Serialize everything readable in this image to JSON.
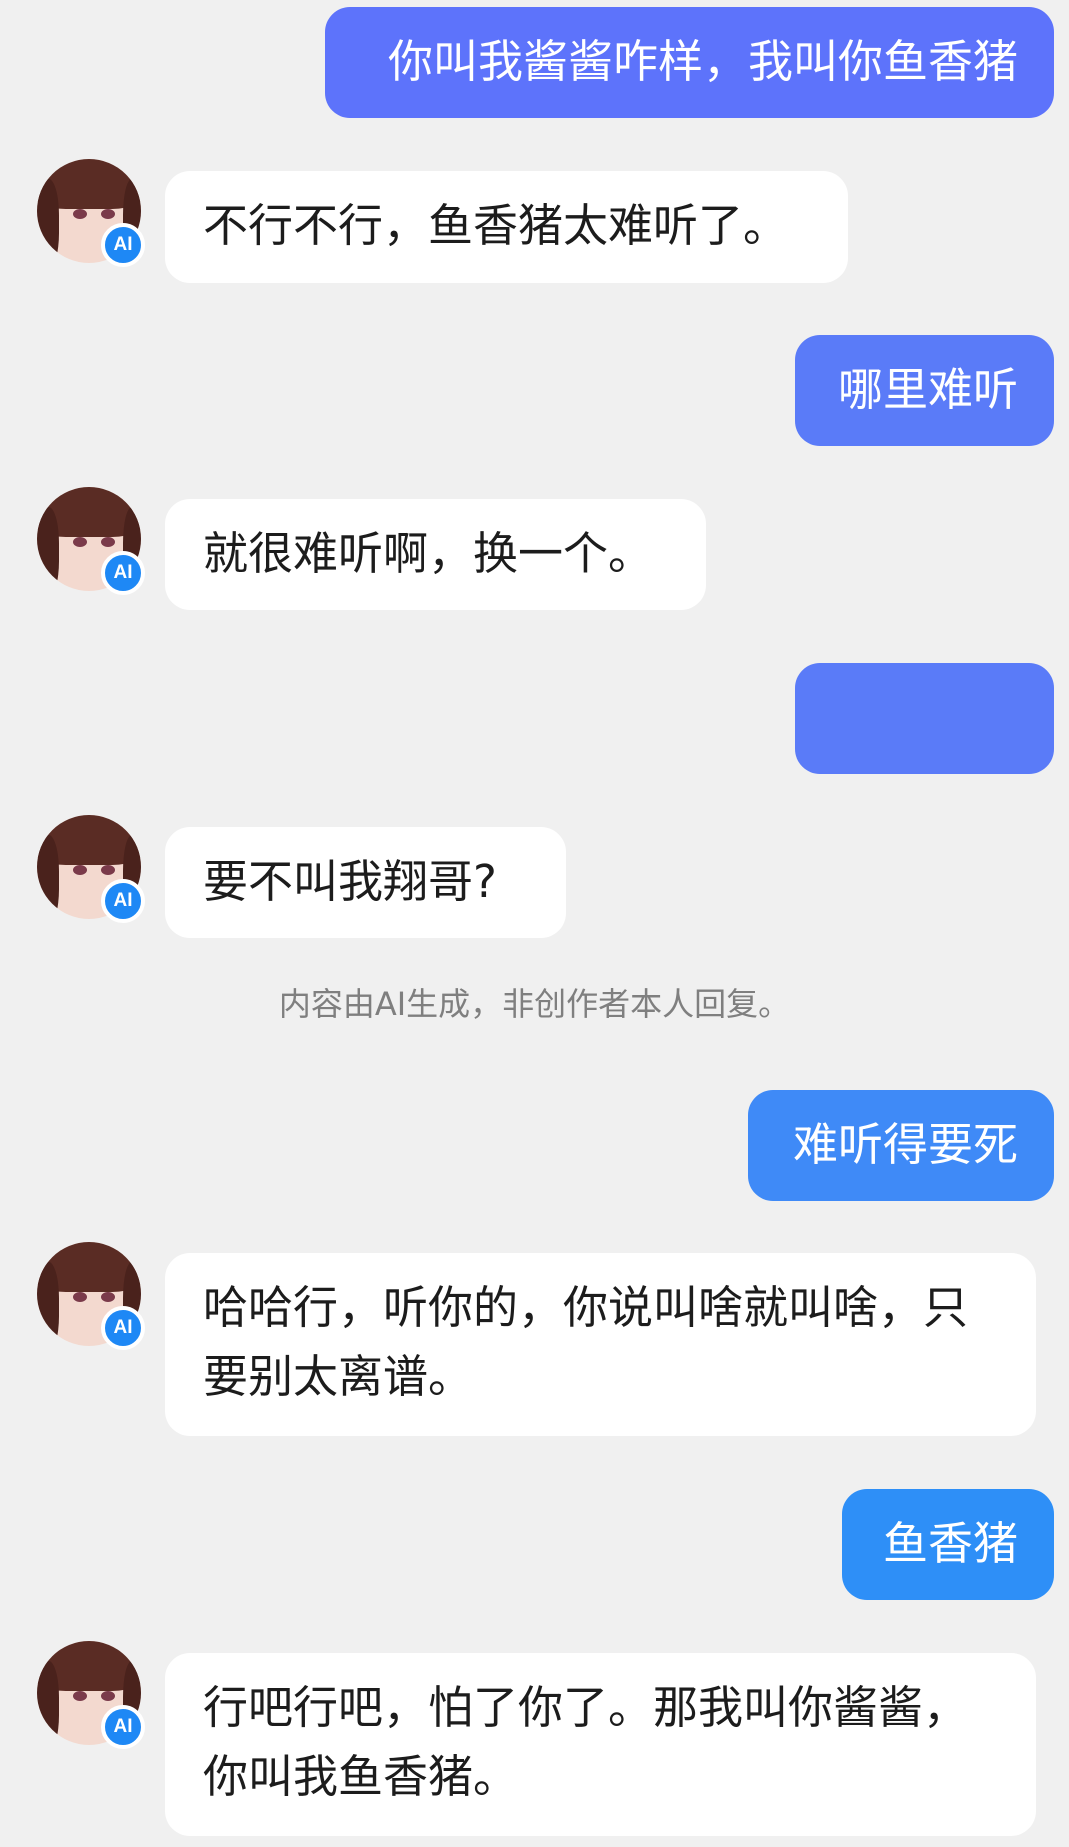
{
  "colors": {
    "background": "#f0f0f0",
    "user_bubble_purple": "#5d73fb",
    "user_bubble_blue_violet": "#5a7bf8",
    "user_bubble_blue": "#3f8af7",
    "user_bubble_sky": "#2e8ff7",
    "ai_bubble": "#ffffff",
    "ai_badge": "#1e88f5",
    "notice_text": "#7f7f7f"
  },
  "icons": {
    "avatar": "anime-girl-avatar",
    "badge": "ai-badge-icon"
  },
  "conversation": {
    "messages": [
      {
        "role": "user",
        "text": "你叫我酱酱咋样，我叫你鱼香猪"
      },
      {
        "role": "ai",
        "badge": "AI",
        "text": "不行不行，鱼香猪太难听了。"
      },
      {
        "role": "user",
        "text": "哪里难听"
      },
      {
        "role": "ai",
        "badge": "AI",
        "text": "就很难听啊，换一个。"
      },
      {
        "role": "user",
        "text": ""
      },
      {
        "role": "ai",
        "badge": "AI",
        "text": "要不叫我翔哥?"
      },
      {
        "role": "user",
        "text": "难听得要死"
      },
      {
        "role": "ai",
        "badge": "AI",
        "text": "哈哈行，听你的，你说叫啥就叫啥，只要别太离谱。"
      },
      {
        "role": "user",
        "text": "鱼香猪"
      },
      {
        "role": "ai",
        "badge": "AI",
        "text": "行吧行吧，怕了你了。那我叫你酱酱，你叫我鱼香猪。"
      }
    ],
    "notice": "内容由AI生成，非创作者本人回复。"
  }
}
